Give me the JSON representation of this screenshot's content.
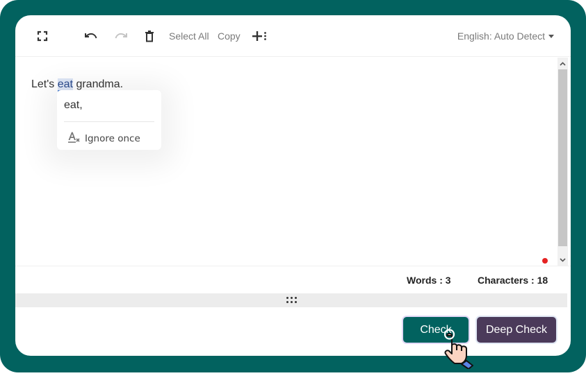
{
  "toolbar": {
    "icons": [
      "fullscreen-icon",
      "undo-icon",
      "redo-icon",
      "trash-icon",
      "add-more-icon"
    ],
    "select_all_label": "Select All",
    "copy_label": "Copy",
    "language_label": "English: Auto Detect"
  },
  "editor": {
    "text_before": "Let's ",
    "flagged_word": "eat",
    "text_after": " grandma."
  },
  "popup": {
    "suggestion": "eat,",
    "ignore_label": "Ignore once"
  },
  "stats": {
    "words_label": "Words : 3",
    "characters_label": "Characters : 18"
  },
  "buttons": {
    "check_label": "Check",
    "deep_check_label": "Deep Check"
  },
  "colors": {
    "frame": "#02625f",
    "check_button": "#02625f",
    "deep_check_button": "#4b3a5a",
    "status_dot": "#e52222"
  }
}
